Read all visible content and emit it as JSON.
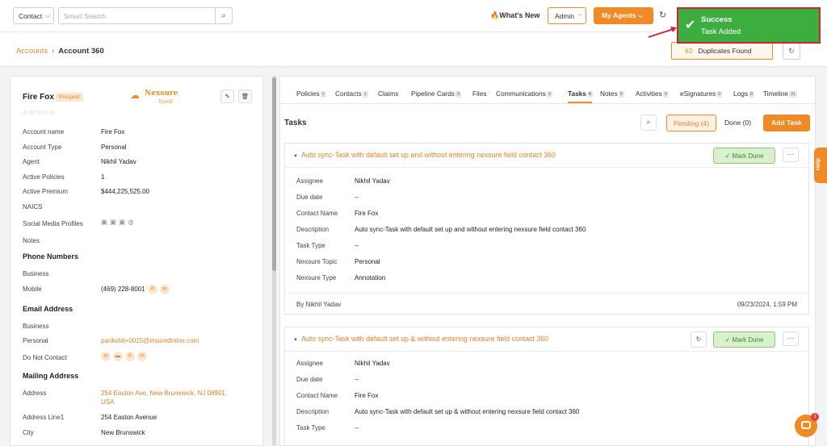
{
  "topbar": {
    "contact_select": "Contact",
    "search_placeholder": "Smart Search",
    "whats_new": "What's New",
    "admin": "Admin",
    "my_agents": "My Agents"
  },
  "toast": {
    "title": "Success",
    "message": "Task Added"
  },
  "breadcrumb": {
    "parent": "Accounts",
    "current": "Account 360"
  },
  "duplicates": {
    "num": "#2",
    "label": "Duplicates Found"
  },
  "account": {
    "name": "Fire Fox",
    "badge": "Prospect",
    "stars": "☆☆☆☆☆",
    "logo_text": "Nexsure",
    "logo_sub": "Tyrell",
    "fields": [
      {
        "label": "Account name",
        "value": "Fire Fox"
      },
      {
        "label": "Account Type",
        "value": "Personal"
      },
      {
        "label": "Agent",
        "value": "Nikhil Yadav"
      },
      {
        "label": "Active Policies",
        "value": "1"
      },
      {
        "label": "Active Premium",
        "value": "$444,225,525.00"
      },
      {
        "label": "NAICS",
        "value": ""
      },
      {
        "label": "Social Media Profiles",
        "value": ""
      },
      {
        "label": "Notes",
        "value": ""
      }
    ],
    "phone_section": "Phone Numbers",
    "phone_fields": [
      {
        "label": "Business",
        "value": ""
      },
      {
        "label": "Mobile",
        "value": "(469) 228-8001"
      }
    ],
    "email_section": "Email Address",
    "email_fields": [
      {
        "label": "Business",
        "value": ""
      },
      {
        "label": "Personal",
        "value": "parikshit+0015@insuredmine.com"
      },
      {
        "label": "Do Not Contact",
        "value": ""
      }
    ],
    "mailing_section": "Mailing Address",
    "mailing_fields": [
      {
        "label": "Address",
        "value": "254 Easton Ave, New Brunswick, NJ 08901,"
      },
      {
        "label": "Address Line1",
        "value": "254 Easton Avenue"
      },
      {
        "label": "City",
        "value": "New Brunswick"
      }
    ],
    "address_line2": "USA"
  },
  "tabs": [
    {
      "label": "Policies",
      "count": "1"
    },
    {
      "label": "Contacts",
      "count": "1"
    },
    {
      "label": "Claims",
      "count": ""
    },
    {
      "label": "Pipeline Cards",
      "count": "0"
    },
    {
      "label": "Files",
      "count": ""
    },
    {
      "label": "Communications",
      "count": "3"
    },
    {
      "label": "Tasks",
      "count": "4"
    },
    {
      "label": "Notes",
      "count": "9"
    },
    {
      "label": "Activities",
      "count": "9"
    },
    {
      "label": "eSignatures",
      "count": "0"
    },
    {
      "label": "Logs",
      "count": "8"
    },
    {
      "label": "Timeline",
      "count": "21"
    }
  ],
  "tasks": {
    "title": "Tasks",
    "pending": "Pending (4)",
    "done": "Done (0)",
    "add": "Add Task",
    "mark_done": "Mark Done",
    "cards": [
      {
        "title": "Auto sync-Task with default set up and without entering nexsure field contact 360",
        "fields": [
          {
            "label": "Assignee",
            "value": "Nikhil Yadav"
          },
          {
            "label": "Due date",
            "value": "--"
          },
          {
            "label": "Contact Name",
            "value": "Fire Fox"
          },
          {
            "label": "Description",
            "value": " Auto sync-Task with default set up and without entering nexsure field contact 360"
          },
          {
            "label": "Task Type",
            "value": "--"
          },
          {
            "label": "Nexsure Topic",
            "value": "Personal"
          },
          {
            "label": "Nexsure Type",
            "value": "Annotation"
          }
        ],
        "by": "By Nikhil Yadav",
        "date": "09/23/2024, 1:59 PM"
      },
      {
        "title": "Auto sync-Task with default set up & without entering nexsure field contact 360",
        "fields": [
          {
            "label": "Assignee",
            "value": "Nikhil Yadav"
          },
          {
            "label": "Due date",
            "value": "--"
          },
          {
            "label": "Contact Name",
            "value": "Fire Fox"
          },
          {
            "label": "Description",
            "value": "Auto sync-Task with default set up & without entering nexsure field contact 360"
          },
          {
            "label": "Task Type",
            "value": "--"
          }
        ]
      }
    ]
  },
  "help": "Help",
  "chat_badge": "1"
}
